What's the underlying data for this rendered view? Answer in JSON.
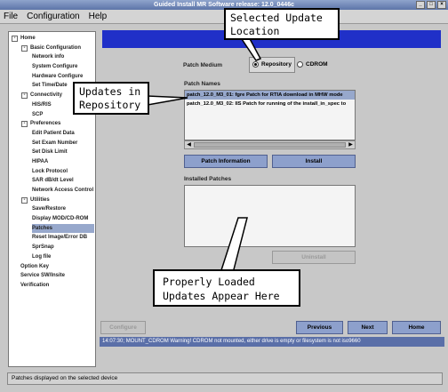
{
  "window": {
    "title": "Guided Install   MR Software release: 12.0_0446c",
    "buttons": [
      "_",
      "□",
      "×"
    ]
  },
  "menu": [
    "File",
    "Configuration",
    "Help"
  ],
  "tree": [
    {
      "label": "Home",
      "level": 0,
      "expander": "-"
    },
    {
      "label": "Basic Configuration",
      "level": 1,
      "expander": "-"
    },
    {
      "label": "Network info",
      "level": 2
    },
    {
      "label": "System Configure",
      "level": 2
    },
    {
      "label": "Hardware Configure",
      "level": 2
    },
    {
      "label": "Set Time/Date",
      "level": 2
    },
    {
      "label": "Connectivity",
      "level": 1,
      "expander": "-"
    },
    {
      "label": "HIS/RIS",
      "level": 2
    },
    {
      "label": "SCP",
      "level": 2
    },
    {
      "label": "Preferences",
      "level": 1,
      "expander": "-"
    },
    {
      "label": "Edit Patient Data",
      "level": 2
    },
    {
      "label": "Set Exam Number",
      "level": 2
    },
    {
      "label": "Set Disk Limit",
      "level": 2
    },
    {
      "label": "HIPAA",
      "level": 2
    },
    {
      "label": "Lock Protocol",
      "level": 2
    },
    {
      "label": "SAR dB/dt Level",
      "level": 2
    },
    {
      "label": "Network Access Control",
      "level": 2
    },
    {
      "label": "Utilities",
      "level": 1,
      "expander": "-"
    },
    {
      "label": "Save/Restore",
      "level": 2
    },
    {
      "label": "Display MOD/CD-ROM",
      "level": 2
    },
    {
      "label": "Patches",
      "level": 2,
      "selected": true
    },
    {
      "label": "Reset Image/Error DB",
      "level": 2
    },
    {
      "label": "SprSnap",
      "level": 2
    },
    {
      "label": "Log file",
      "level": 2
    },
    {
      "label": "Option Key",
      "level": 0
    },
    {
      "label": "Service SW/Insite",
      "level": 0
    },
    {
      "label": "Verification",
      "level": 0
    }
  ],
  "patch_medium": {
    "label": "Patch Medium",
    "options": [
      "Repository",
      "CDROM"
    ],
    "selected": "Repository"
  },
  "patch_names": {
    "label": "Patch Names",
    "items": [
      "patch_12.0_M3_01: fgre Patch for RTIA download in MHW mode",
      "patch_12.0_M3_02: IIS Patch for running of the install_in_spec to"
    ]
  },
  "buttons": {
    "patch_information": "Patch Information",
    "install": "Install",
    "uninstall": "Uninstall",
    "configure": "Configure",
    "previous": "Previous",
    "next": "Next",
    "home": "Home"
  },
  "installed_patches": {
    "label": "Installed Patches"
  },
  "callouts": {
    "selected_location": [
      "Selected Update",
      "Location"
    ],
    "updates_repository": [
      "Updates in",
      "Repository"
    ],
    "properly_loaded": [
      "Properly Loaded",
      "Updates Appear Here"
    ]
  },
  "status_message": "14:07:30; MOUNT_CDROM  Warning!  CDROM not mounted, either drive is empty or filesystem is not iso9660",
  "statusbar": "Patches displayed on the selected device",
  "colors": {
    "accent_bar": "#2030c8",
    "button": "#8da0cc",
    "selection": "#97a8cc",
    "status": "#5a6fa8"
  }
}
